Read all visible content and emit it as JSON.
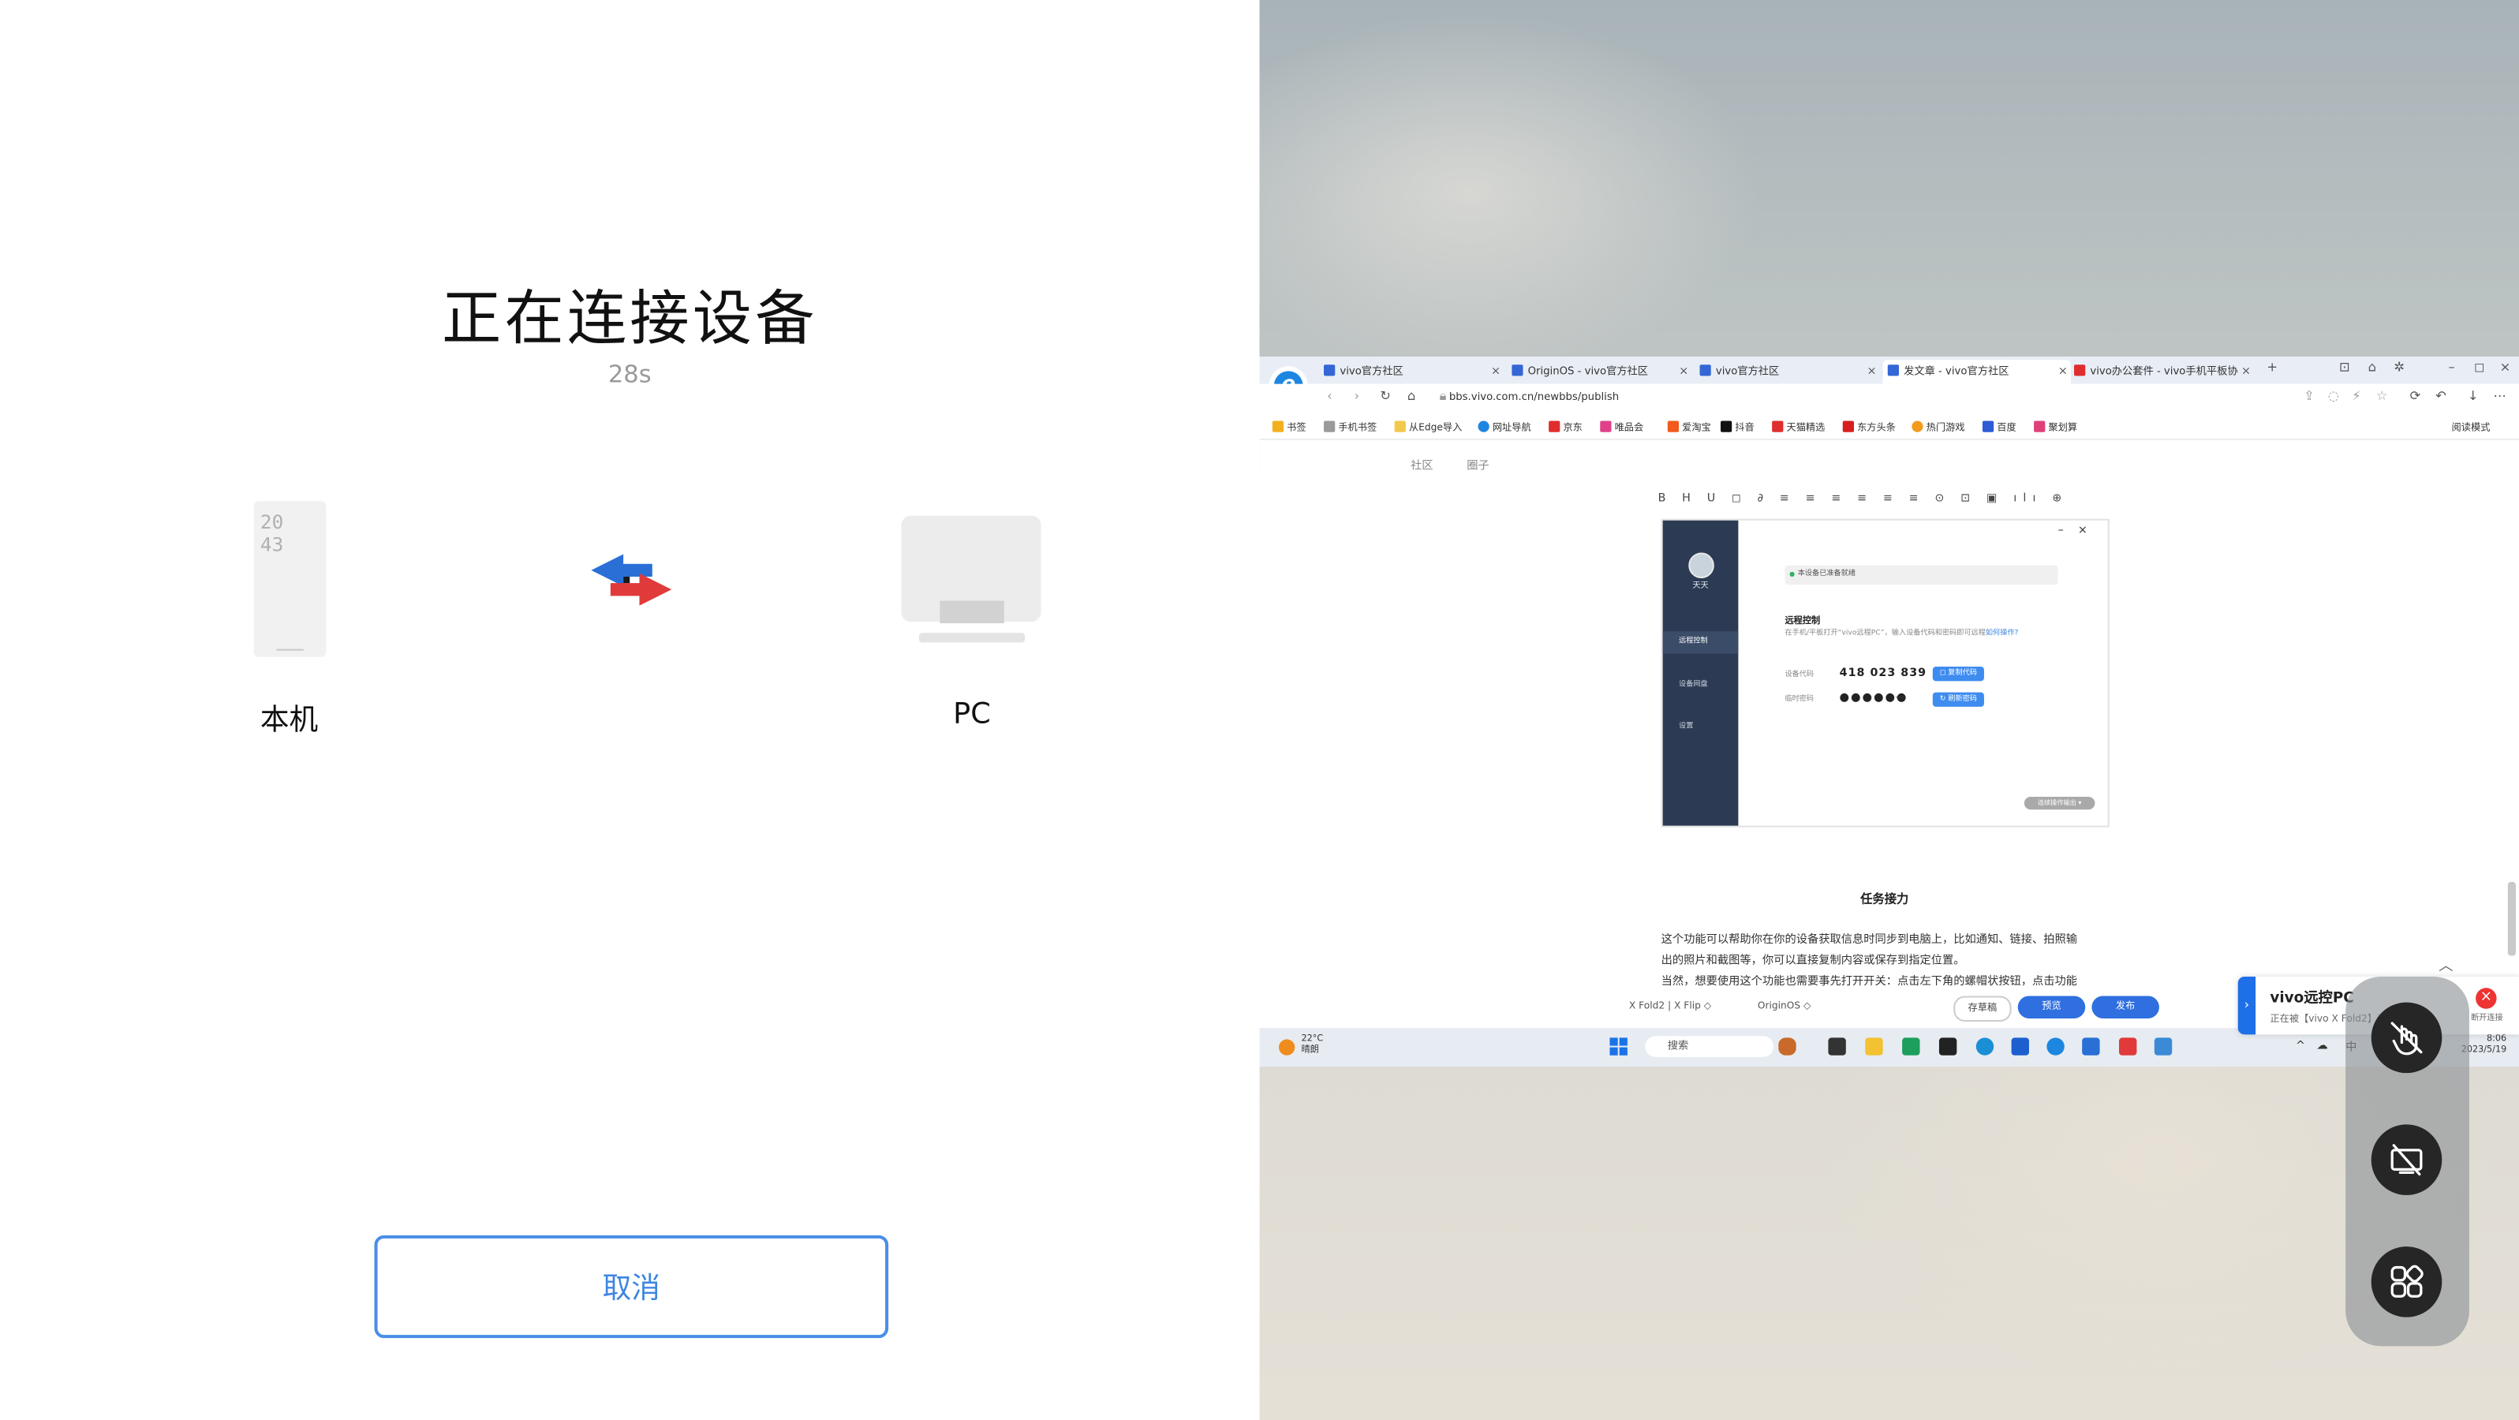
{
  "phone": {
    "title": "正在连接设备",
    "timer": "28s",
    "phone_clock": "20\n43",
    "local_label": "本机",
    "pc_label": "PC",
    "cancel_label": "取消"
  },
  "browser": {
    "tabs": [
      {
        "label": "vivo官方社区",
        "color": "#3466d6"
      },
      {
        "label": "OriginOS - vivo官方社区",
        "color": "#3466d6"
      },
      {
        "label": "vivo官方社区",
        "color": "#3466d6"
      },
      {
        "label": "发文章 - vivo官方社区",
        "color": "#3466d6"
      },
      {
        "label": "vivo办公套件 - vivo手机平板协",
        "color": "#e02e2e"
      }
    ],
    "url": "bbs.vivo.com.cn/newbbs/publish",
    "bookmarks": [
      {
        "label": "书签",
        "color": "#f2b01e"
      },
      {
        "label": "手机书签",
        "color": "#9a9a9a"
      },
      {
        "label": "从Edge导入",
        "color": "#f2c94c"
      },
      {
        "label": "网址导航",
        "color": "#1d86e0"
      },
      {
        "label": "京东",
        "color": "#e02e2e"
      },
      {
        "label": "唯品会",
        "color": "#e0408a"
      },
      {
        "label": "爱淘宝",
        "color": "#f25a1e"
      },
      {
        "label": "抖音",
        "color": "#111111"
      },
      {
        "label": "天猫精选",
        "color": "#e02e2e"
      },
      {
        "label": "东方头条",
        "color": "#d61e1e"
      },
      {
        "label": "热门游戏",
        "color": "#f29a1e"
      },
      {
        "label": "百度",
        "color": "#2e5bd6"
      },
      {
        "label": "聚划算",
        "color": "#e0407a"
      }
    ],
    "reading_mode": "阅读模式"
  },
  "site": {
    "nav": [
      "社区",
      "圈子"
    ],
    "editor_tools": "B H U ◻ ∂ ≡ ≡ ≡ ≡ ≡ ≡ ⊙ ⊡ ▣ ılı ⊕"
  },
  "dialog": {
    "user": "天天",
    "menu": [
      "远程控制",
      "设备网盘",
      "设置"
    ],
    "status": "本设备已准备就绪",
    "heading": "远程控制",
    "desc_prefix": "在手机/平板打开“vivo远程PC”，输入设备代码和密码即可远程",
    "desc_link": "如何操作?",
    "code_label": "设备代码",
    "code": "418 023 839",
    "password_label": "临时密码",
    "password": "●●●●●●",
    "copy_btn": "◻ 复制代码",
    "refresh_btn": "↻ 刷新密码",
    "chip": "连续操作输出 ▾"
  },
  "article": {
    "title": "任务接力",
    "lines": [
      "这个功能可以帮助你在你的设备获取信息时同步到电脑上，比如通知、链接、拍照输",
      "出的照片和截图等，你可以直接复制内容或保存到指定位置。",
      "当然，想要使用这个功能也需要事先打开开关：点击左下角的螺帽状按钮，点击功能"
    ]
  },
  "footer": {
    "device": "X Fold2 | X Flip ◇",
    "os": "OriginOS ◇",
    "draft": "存草稿",
    "preview": "预览",
    "publish": "发布"
  },
  "taskbar": {
    "weather_temp": "22°C",
    "weather_desc": "晴朗",
    "search": "搜索",
    "ime": "中",
    "time": "8:06",
    "date": "2023/5/19"
  },
  "notification": {
    "title": "vivo远控PC",
    "subtitle": "正在被【vivo X Fold2】远程控制",
    "disconnect": "断开连接"
  },
  "colors": {
    "accent": "#3e86e0",
    "swap_blue": "#2a6fd6",
    "swap_red": "#e03a3a",
    "panel_navy": "#2c3b53"
  }
}
